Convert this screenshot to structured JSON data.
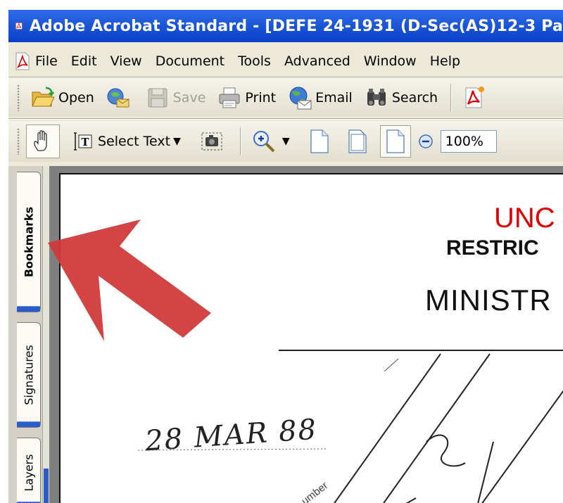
{
  "window": {
    "title": "Adobe Acrobat Standard - [DEFE 24-1931 (D-Sec(AS)12-3 Pa"
  },
  "menu": {
    "items": [
      "File",
      "Edit",
      "View",
      "Document",
      "Tools",
      "Advanced",
      "Window",
      "Help"
    ]
  },
  "toolbar1": {
    "open_label": "Open",
    "save_label": "Save",
    "print_label": "Print",
    "email_label": "Email",
    "search_label": "Search"
  },
  "toolbar2": {
    "select_text_label": "Select Text",
    "zoom_value": "100%"
  },
  "navpane": {
    "tabs": [
      {
        "label": "Bookmarks",
        "active": true
      },
      {
        "label": "Signatures",
        "active": false
      },
      {
        "label": "Layers",
        "active": false
      }
    ]
  },
  "document": {
    "classification": "UNC",
    "restriction": "RESTRIC",
    "heading": "MINISTR",
    "handwritten_date": "28 MAR 88",
    "number_label": "umber"
  },
  "colors": {
    "titlebar": "#0A40C8",
    "classification_red": "#E00000",
    "annotation_arrow": "#D13B3B",
    "nav_accent": "#2A5CCB"
  }
}
